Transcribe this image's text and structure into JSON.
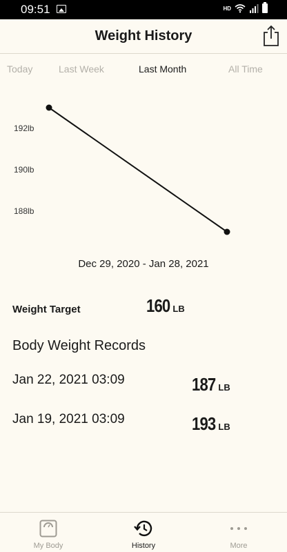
{
  "status_bar": {
    "time": "09:51",
    "network": "HD"
  },
  "header": {
    "title": "Weight History"
  },
  "tabs": [
    {
      "label": "Today",
      "active": false
    },
    {
      "label": "Last Week",
      "active": false
    },
    {
      "label": "Last Month",
      "active": true
    },
    {
      "label": "All Time",
      "active": false
    }
  ],
  "chart_data": {
    "type": "line",
    "title": "",
    "xlabel": "",
    "ylabel": "",
    "y_ticks": [
      "192lb",
      "190lb",
      "188lb"
    ],
    "x": [
      "Jan 19, 2021",
      "Jan 22, 2021"
    ],
    "values": [
      193,
      187
    ],
    "color": "#111111"
  },
  "date_range": "Dec 29, 2020 - Jan 28, 2021",
  "target": {
    "label": "Weight Target",
    "value": "160",
    "unit": "LB"
  },
  "records": {
    "title": "Body Weight Records",
    "items": [
      {
        "date": "Jan 22, 2021 03:09",
        "value": "187",
        "unit": "LB"
      },
      {
        "date": "Jan 19, 2021 03:09",
        "value": "193",
        "unit": "LB"
      }
    ]
  },
  "nav": [
    {
      "label": "My Body",
      "icon": "scale-icon",
      "active": false
    },
    {
      "label": "History",
      "icon": "history-icon",
      "active": true
    },
    {
      "label": "More",
      "icon": "more-dots-icon",
      "active": false
    }
  ]
}
